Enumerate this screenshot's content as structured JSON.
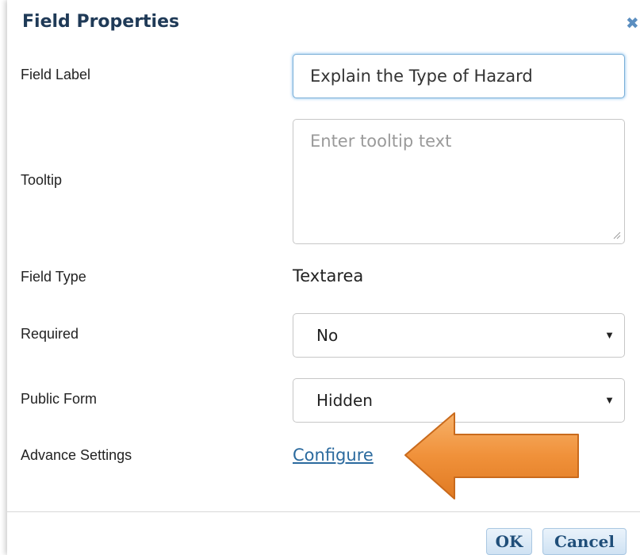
{
  "dialog": {
    "title": "Field Properties",
    "close_glyph": "✖"
  },
  "fields": {
    "field_label": {
      "label": "Field Label",
      "value": "Explain the Type of Hazard"
    },
    "tooltip": {
      "label": "Tooltip",
      "placeholder": "Enter tooltip text"
    },
    "field_type": {
      "label": "Field Type",
      "value": "Textarea"
    },
    "required": {
      "label": "Required",
      "selected": "No"
    },
    "public_form": {
      "label": "Public Form",
      "selected": "Hidden"
    },
    "advance_settings": {
      "label": "Advance Settings",
      "link": "Configure"
    }
  },
  "footer": {
    "ok_label": "OK",
    "cancel_label": "Cancel"
  },
  "colors": {
    "title": "#1f3a57",
    "link": "#2b6a9e",
    "arrow": "#f0913a",
    "focus_border": "#7aaed6"
  },
  "icons": {
    "close": "close-icon",
    "dropdown": "caret-down-icon",
    "callout": "arrow-left-icon"
  }
}
